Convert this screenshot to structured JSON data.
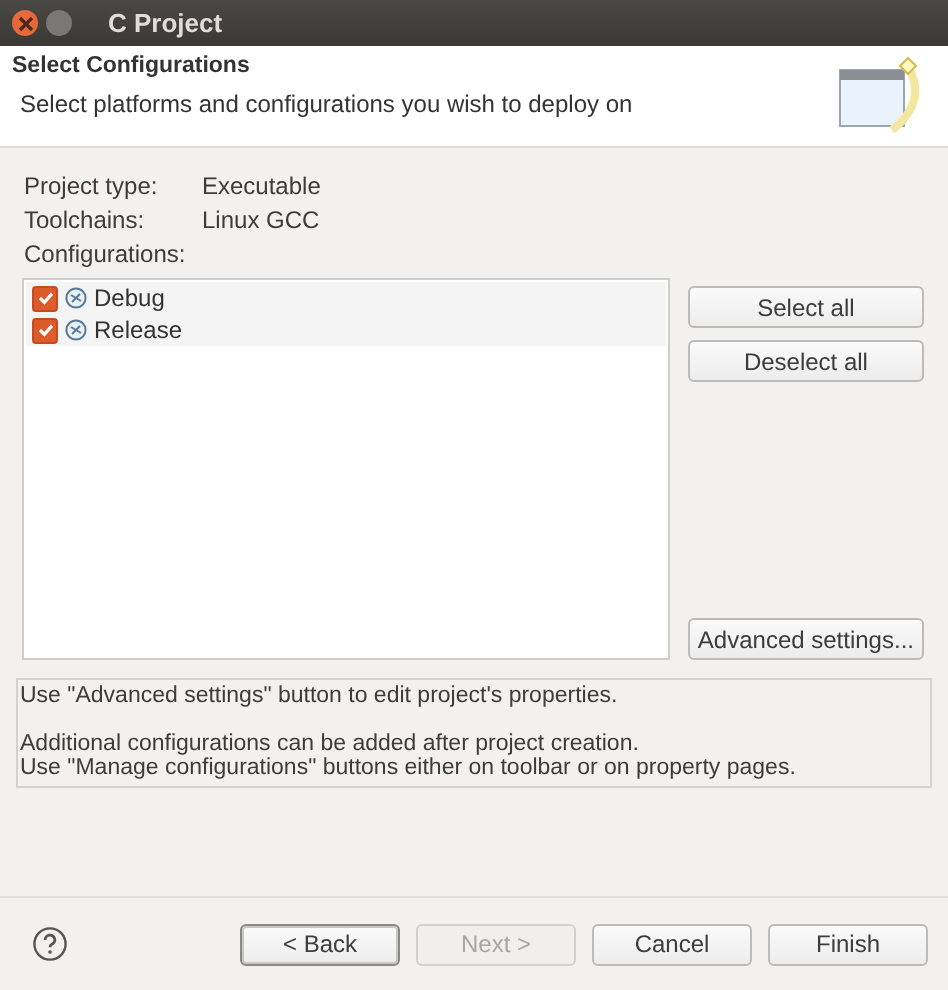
{
  "window": {
    "title": "C Project"
  },
  "header": {
    "title": "Select Configurations",
    "description": "Select platforms and configurations you wish to deploy on"
  },
  "properties": [
    {
      "label": "Project type:",
      "value": "Executable"
    },
    {
      "label": "Toolchains:",
      "value": "Linux GCC"
    },
    {
      "label": "Configurations:"
    }
  ],
  "configurations": [
    {
      "name": "Debug",
      "checked": true
    },
    {
      "name": "Release",
      "checked": true
    }
  ],
  "side_buttons": {
    "top": [
      "Select all",
      "Deselect all"
    ],
    "bottom": "Advanced settings..."
  },
  "info": [
    [
      "Use \"Advanced settings\" button to edit project's properties."
    ],
    [
      "Additional configurations can be added after project creation.",
      "Use \"Manage configurations\" buttons either on toolbar or on property pages."
    ]
  ],
  "buttons": [
    {
      "label": "< Back",
      "disabled": false,
      "default": true
    },
    {
      "label": "Next >",
      "disabled": true,
      "default": false
    },
    {
      "label": "Cancel",
      "disabled": false,
      "default": false
    },
    {
      "label": "Finish",
      "disabled": false,
      "default": false
    }
  ]
}
